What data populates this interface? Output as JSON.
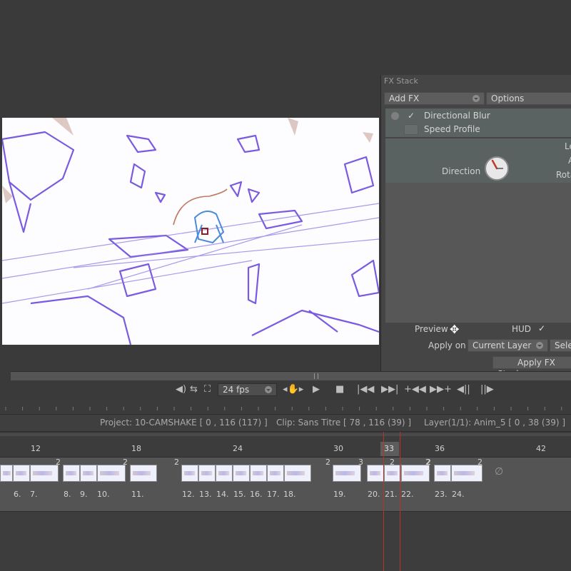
{
  "fx_stack": {
    "title": "FX Stack",
    "add_fx": "Add FX",
    "options": "Options",
    "effects": [
      {
        "label": "Directional Blur",
        "checked": true
      },
      {
        "label": "Speed Profile",
        "checked": false
      }
    ],
    "params": {
      "direction_label": "Direction",
      "right_labels": [
        "Le",
        "A",
        "Rota"
      ]
    },
    "preview_label": "Preview",
    "hud_label": "HUD",
    "apply_on_label": "Apply on",
    "apply_on_value": "Current Layer",
    "select_label": "Selec",
    "apply_button": "Apply FX Stack"
  },
  "transport": {
    "fps": "24 fps"
  },
  "info": {
    "project": "Project: 10-CAMSHAKE [ 0 , 116  (117) ]",
    "clip": "Clip: Sans Titre [ 78 , 116  (39) ]",
    "layer": "Layer(1/1): Anim_5 [ 0 , 38  (39) ]"
  },
  "ruler_numbers": [
    "12",
    "18",
    "24",
    "30",
    "33",
    "36",
    "42"
  ],
  "frame_labels": [
    "6.",
    "7.",
    "8.",
    "9.",
    "10.",
    "11.",
    "12.",
    "13.",
    "14.",
    "15.",
    "16.",
    "17.",
    "18.",
    "19.",
    "20.",
    "21.",
    "22.",
    "23.",
    "24."
  ],
  "hold_marks": [
    "2",
    "2",
    "2",
    "2",
    "3",
    "2",
    "2",
    "2",
    "2"
  ],
  "colors": {
    "accent_red": "#c0392b",
    "playhead": "#b5332a",
    "sketch_purple": "#6a4fd8"
  }
}
